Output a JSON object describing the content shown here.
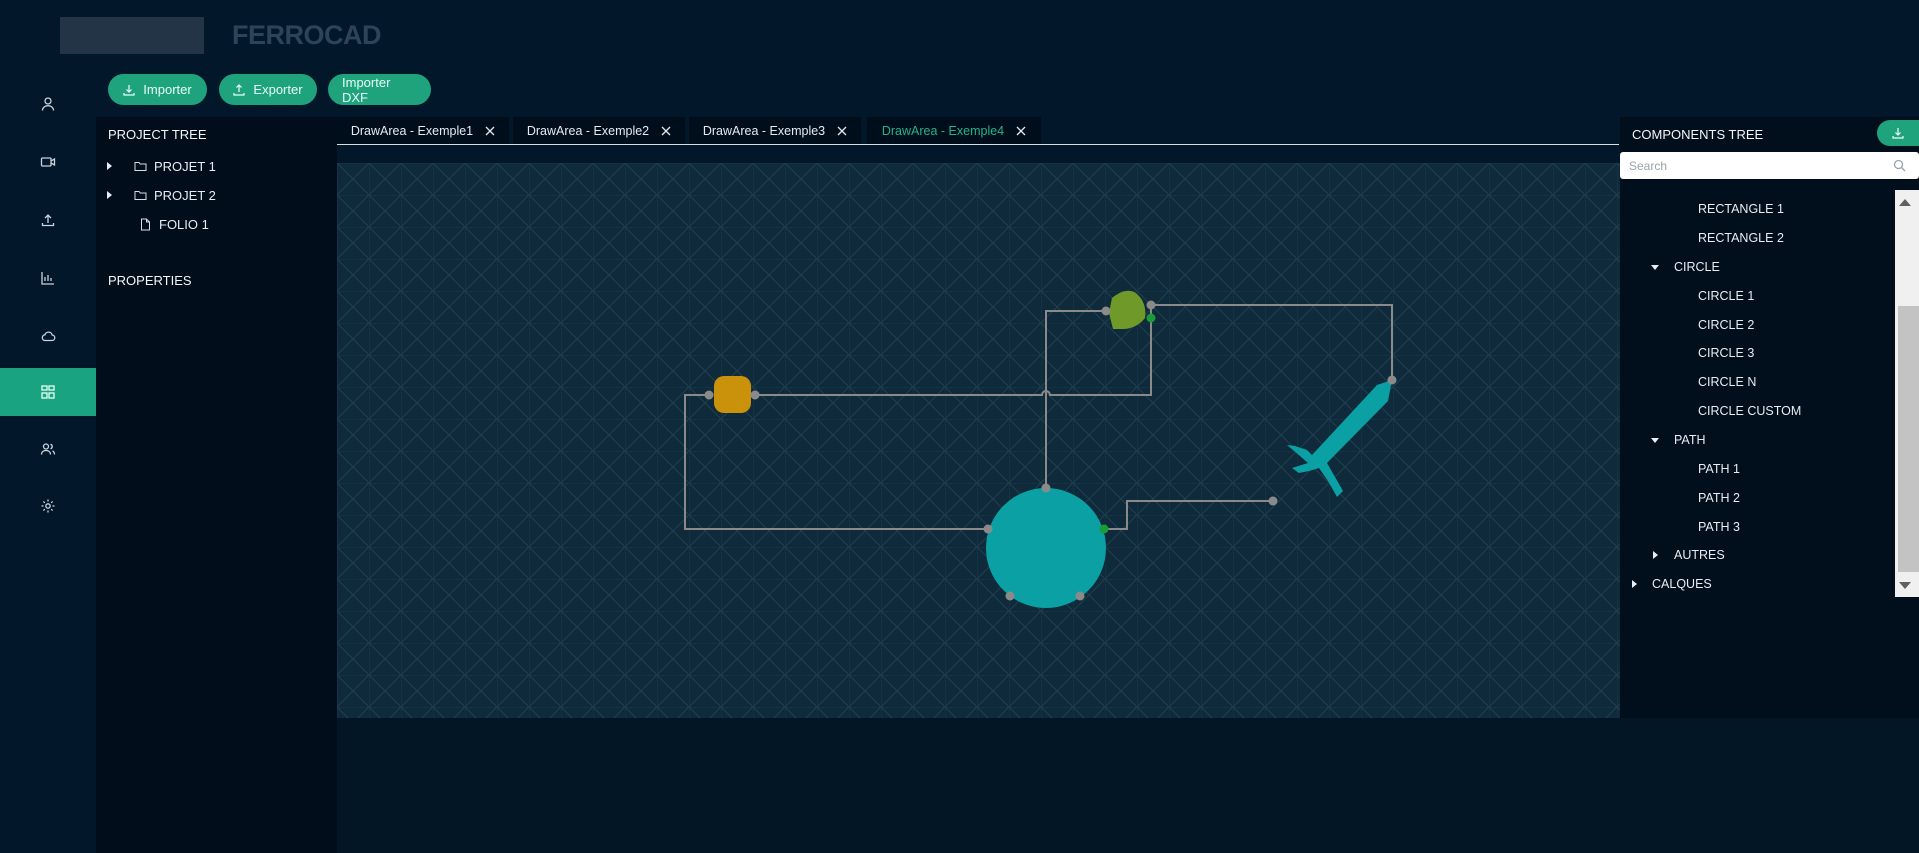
{
  "app": {
    "title": "FERROCAD"
  },
  "rail": {
    "items": [
      {
        "icon": "user-icon"
      },
      {
        "icon": "video-icon"
      },
      {
        "icon": "upload-icon"
      },
      {
        "icon": "chart-icon"
      },
      {
        "icon": "cloud-icon"
      },
      {
        "icon": "grid-icon",
        "active": true
      },
      {
        "icon": "users-icon"
      },
      {
        "icon": "gear-icon"
      }
    ]
  },
  "toolbar": {
    "import_label": "Importer",
    "export_label": "Exporter",
    "import_dxf_label": "Importer DXF"
  },
  "project_tree": {
    "title": "PROJECT TREE",
    "items": [
      {
        "label": "PROJET 1",
        "type": "folder"
      },
      {
        "label": "PROJET 2",
        "type": "folder"
      },
      {
        "label": "FOLIO 1",
        "type": "file"
      }
    ]
  },
  "properties": {
    "title": "PROPERTIES"
  },
  "tabs": [
    {
      "label": "DrawArea - Exemple1"
    },
    {
      "label": "DrawArea - Exemple2"
    },
    {
      "label": "DrawArea - Exemple3"
    },
    {
      "label": "DrawArea - Exemple4",
      "active": true
    }
  ],
  "components_tree": {
    "title": "COMPONENTS TREE",
    "search_placeholder": "Search",
    "items": [
      {
        "label": "RECTANGLE 1",
        "level": 2
      },
      {
        "label": "RECTANGLE 2",
        "level": 2
      },
      {
        "label": "CIRCLE",
        "level": 1,
        "expanded": true
      },
      {
        "label": "CIRCLE 1",
        "level": 2
      },
      {
        "label": "CIRCLE 2",
        "level": 2
      },
      {
        "label": "CIRCLE 3",
        "level": 2
      },
      {
        "label": "CIRCLE N",
        "level": 2
      },
      {
        "label": "CIRCLE CUSTOM",
        "level": 2
      },
      {
        "label": "PATH",
        "level": 1,
        "expanded": true
      },
      {
        "label": "PATH 1",
        "level": 2
      },
      {
        "label": "PATH 2",
        "level": 2
      },
      {
        "label": "PATH 3",
        "level": 2
      },
      {
        "label": "AUTRES",
        "level": 1,
        "expanded": false
      },
      {
        "label": "CALQUES",
        "level": 0,
        "expanded": false
      }
    ]
  },
  "colors": {
    "accent": "#1fa37d",
    "canvas": "#0f2a3a",
    "circle": "#0aa0a4",
    "rounded_square": "#c9920a",
    "shield_shape": "#6f9a2a",
    "sword_shape": "#0aa0a4",
    "wire": "#8a8a8a",
    "port_green": "#1b9a3a"
  }
}
